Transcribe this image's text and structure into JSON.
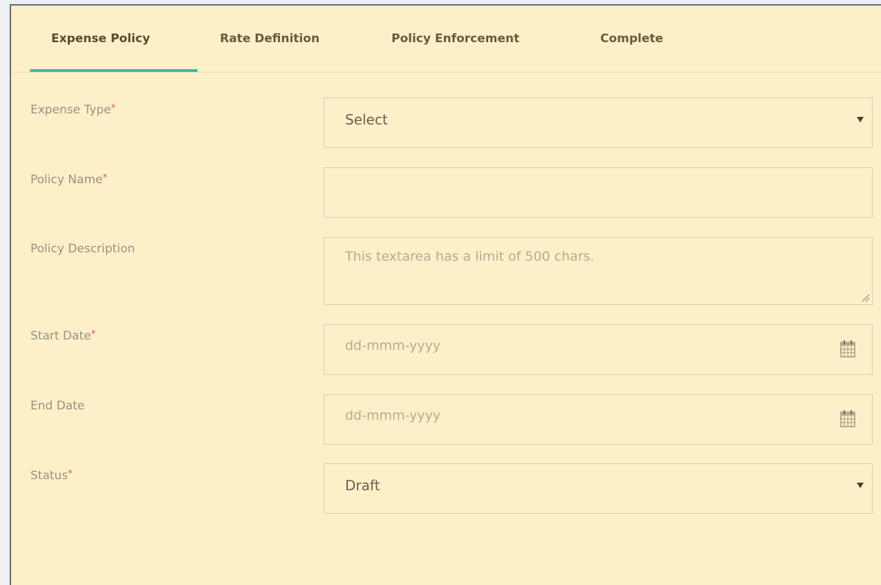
{
  "tabs": [
    {
      "label": "Expense Policy",
      "active": true
    },
    {
      "label": "Rate Definition",
      "active": false
    },
    {
      "label": "Policy Enforcement",
      "active": false
    },
    {
      "label": "Complete",
      "active": false
    }
  ],
  "accent_color": "#3bb7a6",
  "required_marker": "*",
  "form": {
    "expense_type": {
      "label": "Expense Type",
      "value": "Select"
    },
    "policy_name": {
      "label": "Policy Name",
      "value": ""
    },
    "policy_description": {
      "label": "Policy Description",
      "placeholder": "This textarea has a limit of 500 chars."
    },
    "start_date": {
      "label": "Start Date",
      "placeholder": "dd-mmm-yyyy",
      "icon": "calendar-icon"
    },
    "end_date": {
      "label": "End Date",
      "placeholder": "dd-mmm-yyyy",
      "icon": "calendar-icon"
    },
    "status": {
      "label": "Status",
      "value": "Draft"
    }
  }
}
